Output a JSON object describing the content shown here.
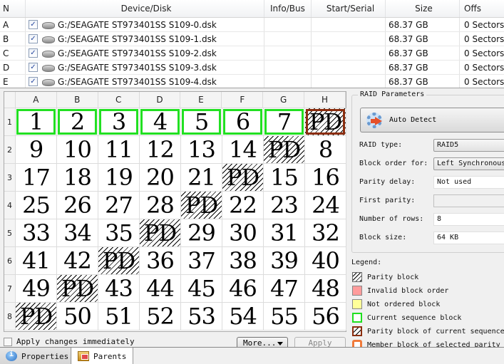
{
  "disk_table": {
    "columns": [
      "N",
      "Device/Disk",
      "Info/Bus",
      "Start/Serial",
      "Size",
      "Offs"
    ],
    "rows": [
      {
        "n": "A",
        "checked": true,
        "device": "G:/SEAGATE ST973401SS S109-0.dsk",
        "info": "",
        "start": "",
        "size": "68.37 GB",
        "offset": "0 Sectors"
      },
      {
        "n": "B",
        "checked": true,
        "device": "G:/SEAGATE ST973401SS S109-1.dsk",
        "info": "",
        "start": "",
        "size": "68.37 GB",
        "offset": "0 Sectors"
      },
      {
        "n": "C",
        "checked": true,
        "device": "G:/SEAGATE ST973401SS S109-2.dsk",
        "info": "",
        "start": "",
        "size": "68.37 GB",
        "offset": "0 Sectors"
      },
      {
        "n": "D",
        "checked": true,
        "device": "G:/SEAGATE ST973401SS S109-3.dsk",
        "info": "",
        "start": "",
        "size": "68.37 GB",
        "offset": "0 Sectors"
      },
      {
        "n": "E",
        "checked": true,
        "device": "G:/SEAGATE ST973401SS S109-4.dsk",
        "info": "",
        "start": "",
        "size": "68.37 GB",
        "offset": "0 Sectors"
      }
    ],
    "check_glyph": "✓"
  },
  "grid": {
    "col_headers": [
      "A",
      "B",
      "C",
      "D",
      "E",
      "F",
      "G",
      "H"
    ],
    "row_headers": [
      "1",
      "2",
      "3",
      "4",
      "5",
      "6",
      "7",
      "8"
    ],
    "rows": [
      [
        {
          "v": "1",
          "t": "current"
        },
        {
          "v": "2",
          "t": "current"
        },
        {
          "v": "3",
          "t": "current"
        },
        {
          "v": "4",
          "t": "current"
        },
        {
          "v": "5",
          "t": "current"
        },
        {
          "v": "6",
          "t": "current"
        },
        {
          "v": "7",
          "t": "current"
        },
        {
          "v": "PD",
          "t": "cur-parity"
        }
      ],
      [
        {
          "v": "9"
        },
        {
          "v": "10"
        },
        {
          "v": "11"
        },
        {
          "v": "12"
        },
        {
          "v": "13"
        },
        {
          "v": "14"
        },
        {
          "v": "PD",
          "t": "parity"
        },
        {
          "v": "8"
        }
      ],
      [
        {
          "v": "17"
        },
        {
          "v": "18"
        },
        {
          "v": "19"
        },
        {
          "v": "20"
        },
        {
          "v": "21"
        },
        {
          "v": "PD",
          "t": "parity"
        },
        {
          "v": "15"
        },
        {
          "v": "16"
        }
      ],
      [
        {
          "v": "25"
        },
        {
          "v": "26"
        },
        {
          "v": "27"
        },
        {
          "v": "28"
        },
        {
          "v": "PD",
          "t": "parity"
        },
        {
          "v": "22"
        },
        {
          "v": "23"
        },
        {
          "v": "24"
        }
      ],
      [
        {
          "v": "33"
        },
        {
          "v": "34"
        },
        {
          "v": "35"
        },
        {
          "v": "PD",
          "t": "parity"
        },
        {
          "v": "29"
        },
        {
          "v": "30"
        },
        {
          "v": "31"
        },
        {
          "v": "32"
        }
      ],
      [
        {
          "v": "41"
        },
        {
          "v": "42"
        },
        {
          "v": "PD",
          "t": "parity"
        },
        {
          "v": "36"
        },
        {
          "v": "37"
        },
        {
          "v": "38"
        },
        {
          "v": "39"
        },
        {
          "v": "40"
        }
      ],
      [
        {
          "v": "49"
        },
        {
          "v": "PD",
          "t": "parity"
        },
        {
          "v": "43"
        },
        {
          "v": "44"
        },
        {
          "v": "45"
        },
        {
          "v": "46"
        },
        {
          "v": "47"
        },
        {
          "v": "48"
        }
      ],
      [
        {
          "v": "PD",
          "t": "parity"
        },
        {
          "v": "50"
        },
        {
          "v": "51"
        },
        {
          "v": "52"
        },
        {
          "v": "53"
        },
        {
          "v": "54"
        },
        {
          "v": "55"
        },
        {
          "v": "56"
        }
      ]
    ]
  },
  "controls": {
    "apply_immediately_label": "Apply changes immediately",
    "apply_immediately_checked": false,
    "more_label": "More...",
    "apply_label": "Apply"
  },
  "raid_params": {
    "title": "RAID Parameters",
    "auto_detect_label": "Auto Detect",
    "fields": {
      "raid_type": {
        "label": "RAID type:",
        "value": "RAID5"
      },
      "block_order": {
        "label": "Block order for:",
        "value": "Left Synchronous"
      },
      "parity_delay": {
        "label": "Parity delay:",
        "value": "Not used"
      },
      "first_parity": {
        "label": "First parity:",
        "value": ""
      },
      "num_rows": {
        "label": "Number of rows:",
        "value": "8"
      },
      "block_size": {
        "label": "Block size:",
        "value": "64 KB"
      }
    }
  },
  "legend": {
    "title": "Legend:",
    "items": [
      {
        "label": "Parity block",
        "swatch": "parity"
      },
      {
        "label": "Invalid block order",
        "swatch": "invalid",
        "color": "#ff9c9c"
      },
      {
        "label": "Not ordered block",
        "swatch": "notord",
        "color": "#ffff99"
      },
      {
        "label": "Current sequence block",
        "swatch": "current",
        "color": "#20e020"
      },
      {
        "label": "Parity block of current sequence",
        "swatch": "curpar",
        "color": "#8b2e0f"
      },
      {
        "label": "Member block of selected parity",
        "swatch": "member",
        "color": "#f07a3a"
      }
    ]
  },
  "tabs": [
    {
      "label": "Properties",
      "icon": "properties-icon",
      "active": false
    },
    {
      "label": "Parents",
      "icon": "parents-icon",
      "active": true
    }
  ]
}
